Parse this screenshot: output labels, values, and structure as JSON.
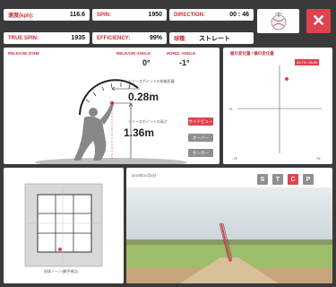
{
  "stats": {
    "speed_label": "速度(kph):",
    "speed_value": "116.6",
    "spin_label": "SPIN:",
    "spin_value": "1950",
    "direction_label": "DIRECTION:",
    "direction_value": "00 : 46",
    "true_spin_label": "TRUE SPIN:",
    "true_spin_value": "1935",
    "efficiency_label": "EFFICIENCY:",
    "efficiency_value": "99%",
    "pitch_type_label": "球種:",
    "pitch_type_value": "ストレート"
  },
  "release": {
    "title": "RELEASE ZONE",
    "release_angle_label": "RELEASE ANGLE",
    "release_angle_value": "0°",
    "horiz_angle_label": "HORIZ. ANGLE",
    "horiz_angle_value": "-1°",
    "ext_label": "リリースポイントの前後距離",
    "ext_value": "0.28m",
    "height_label": "リリースポイントの高さ",
    "height_value": "1.36m",
    "buttons": [
      "サイドビュー",
      "オーバー",
      "センター"
    ]
  },
  "movement": {
    "title": "縦の変化量 / 横の変化量",
    "badge": "25.78 / 35.89",
    "x_left": "-75",
    "x_right": "75",
    "y_label": "75"
  },
  "strike_zone": {
    "label": "投球ゾーン(捕手視点)"
  },
  "trajectory": {
    "date": "2015年10月8日",
    "views": [
      "S",
      "T",
      "C",
      "P"
    ]
  },
  "colors": {
    "accent": "#e0424f",
    "stat_label": "#c8323c",
    "background": "#3a3a3a"
  }
}
